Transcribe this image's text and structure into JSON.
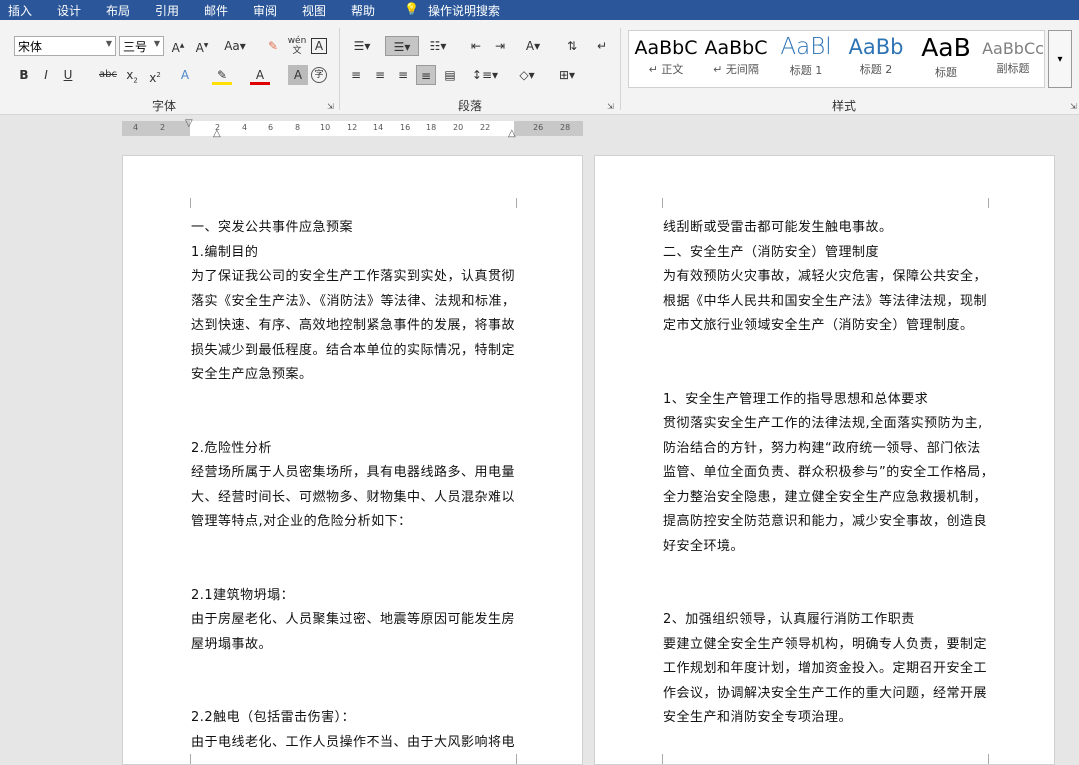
{
  "tabs": [
    "插入",
    "设计",
    "布局",
    "引用",
    "邮件",
    "审阅",
    "视图",
    "帮助"
  ],
  "tell_me": "操作说明搜索",
  "font": {
    "name": "宋体",
    "size": "三号",
    "group_label": "字体"
  },
  "paragraph": {
    "group_label": "段落"
  },
  "styles": {
    "group_label": "样式",
    "items": [
      {
        "preview": "AaBbC",
        "name": "↵ 正文",
        "color": "#000000"
      },
      {
        "preview": "AaBbC",
        "name": "↵ 无间隔",
        "color": "#000000"
      },
      {
        "preview": "AaBl",
        "name": "标题 1",
        "color": "#2e74b5"
      },
      {
        "preview": "AaBb",
        "name": "标题 2",
        "color": "#2e74b5"
      },
      {
        "preview": "AaB",
        "name": "标题",
        "color": "#000000"
      },
      {
        "preview": "AaBbCc",
        "name": "副标题",
        "color": "#7f7f7f"
      }
    ]
  },
  "ruler": [
    "4",
    "2",
    "2",
    "4",
    "6",
    "8",
    "10",
    "12",
    "14",
    "16",
    "18",
    "20",
    "22",
    "26",
    "28"
  ],
  "accent": "#2b579a",
  "page1": [
    "一、突发公共事件应急预案",
    "1.编制目的",
    "为了保证我公司的安全生产工作落实到实处，认真贯彻",
    "落实《安全生产法》、《消防法》等法律、法规和标准，",
    "达到快速、有序、高效地控制紧急事件的发展，将事故",
    "损失减少到最低程度。结合本单位的实际情况，特制定",
    "安全生产应急预案。",
    "",
    "",
    "2.危险性分析",
    "经营场所属于人员密集场所，具有电器线路多、用电量",
    "大、经营时间长、可燃物多、财物集中、人员混杂难以",
    "管理等特点,对企业的危险分析如下：",
    "",
    "",
    "2.1建筑物坍塌：",
    "由于房屋老化、人员聚集过密、地震等原因可能发生房",
    "屋坍塌事故。",
    "",
    "",
    "2.2触电（包括雷击伤害）：",
    "由于电线老化、工作人员操作不当、由于大风影响将电"
  ],
  "page2": [
    "线刮断或受雷击都可能发生触电事故。",
    "二、安全生产（消防安全）管理制度",
    "为有效预防火灾事故，减轻火灾危害，保障公共安全，",
    "根据《中华人民共和国安全生产法》等法律法规，现制",
    "定市文旅行业领域安全生产（消防安全）管理制度。",
    "",
    "",
    "1、安全生产管理工作的指导思想和总体要求",
    "贯彻落实安全生产工作的法律法规,全面落实预防为主,",
    "防治结合的方针，努力构建“政府统一领导、部门依法",
    "监管、单位全面负责、群众积极参与”的安全工作格局，",
    "全力整治安全隐患，建立健全安全生产应急救援机制，",
    "提高防控安全防范意识和能力，减少安全事故，创造良",
    "好安全环境。",
    "",
    "",
    "2、加强组织领导，认真履行消防工作职责",
    "要建立健全安全生产领导机构，明确专人负责，要制定",
    "工作规划和年度计划，增加资金投入。定期召开安全工",
    "作会议，协调解决安全生产工作的重大问题，经常开展",
    "安全生产和消防安全专项治理。"
  ]
}
